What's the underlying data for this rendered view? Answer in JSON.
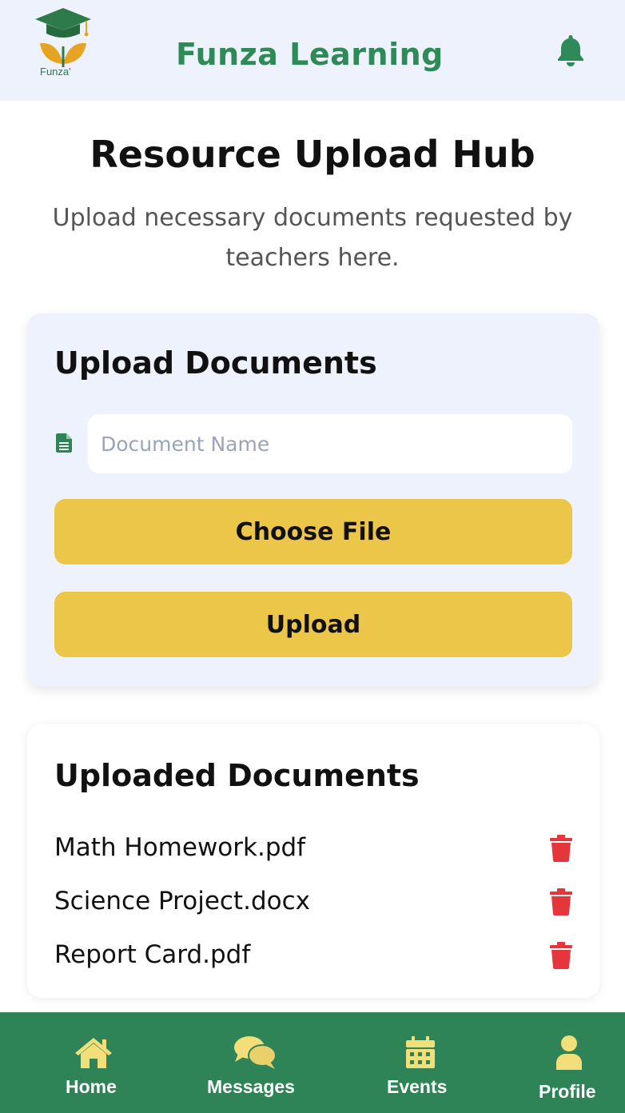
{
  "header": {
    "logo_text": "Funza'",
    "app_title": "Funza Learning",
    "notification_icon": "bell-icon"
  },
  "page": {
    "title": "Resource Upload Hub",
    "subtitle": "Upload necessary documents requested by teachers here."
  },
  "upload_card": {
    "title": "Upload Documents",
    "document_name_placeholder": "Document Name",
    "document_name_value": "",
    "choose_file_label": "Choose File",
    "upload_label": "Upload"
  },
  "uploaded_card": {
    "title": "Uploaded Documents",
    "documents": [
      {
        "name": "Math Homework.pdf",
        "action_icon": "trash-icon"
      },
      {
        "name": "Science Project.docx",
        "action_icon": "trash-icon"
      },
      {
        "name": "Report Card.pdf",
        "action_icon": "trash-icon"
      }
    ]
  },
  "bottom_nav": {
    "items": [
      {
        "label": "Home",
        "icon": "home-icon"
      },
      {
        "label": "Messages",
        "icon": "chat-icon"
      },
      {
        "label": "Events",
        "icon": "calendar-icon"
      },
      {
        "label": "Profile",
        "icon": "user-icon"
      }
    ]
  },
  "colors": {
    "brand_green": "#2e8457",
    "header_bg": "#eef2fc",
    "accent_yellow": "#ecc648",
    "delete_red": "#e5373b",
    "nav_icon_yellow": "#f3df79"
  }
}
